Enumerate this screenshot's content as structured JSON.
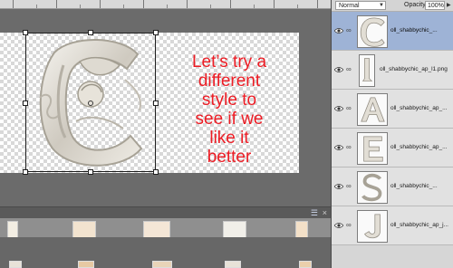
{
  "canvas": {
    "overlay_text": [
      "Let’s try a",
      "different",
      "style to",
      "see if we",
      "like it",
      "better"
    ]
  },
  "bin": {
    "menu_icon": "panel-menu-icon",
    "close_icon": "close-icon"
  },
  "layers_panel": {
    "blend_mode": "Normal",
    "opacity_label": "Opacity:",
    "opacity_value": "100%",
    "layers": [
      {
        "name": "oll_shabbychic_...",
        "selected": true,
        "thumb": "letter-c"
      },
      {
        "name": "oll_shabbychic_ap_l1.png",
        "selected": false,
        "thumb": "letter-l"
      },
      {
        "name": "oll_shabbychic_ap_...",
        "selected": false,
        "thumb": "letter-a"
      },
      {
        "name": "oll_shabbychic_ap_...",
        "selected": false,
        "thumb": "letter-e"
      },
      {
        "name": "oll_shabbychic_...",
        "selected": false,
        "thumb": "letter-s"
      },
      {
        "name": "oll_shabbychic_ap_j...",
        "selected": false,
        "thumb": "letter-j"
      }
    ]
  },
  "colors": {
    "overlay_text": "#ed1c24",
    "selected_layer": "#9eb3d6",
    "workspace": "#6b6b6b"
  }
}
